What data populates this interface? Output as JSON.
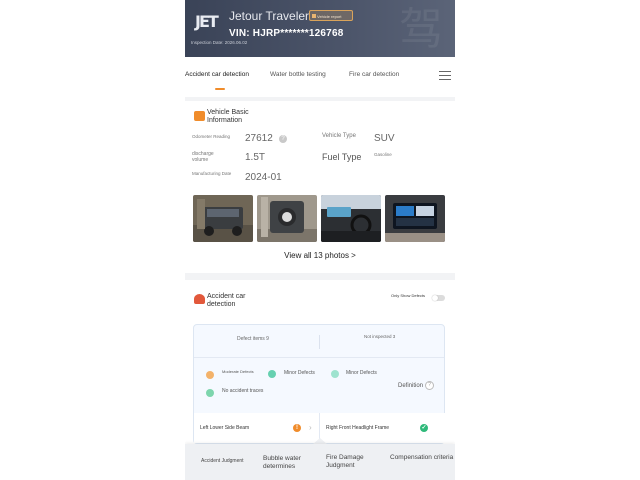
{
  "header": {
    "brand_logo": "JET",
    "car_model": "Jetour Traveler",
    "report_badge": "Vehicle report",
    "vin": "VIN: HJRP*******126768",
    "inspection_date": "Inspection Date: 2026.06.02",
    "watermark": "驾"
  },
  "tabs": [
    {
      "label": "Accident car detection",
      "active": true
    },
    {
      "label": "Water bottle testing",
      "active": false
    },
    {
      "label": "Fire car detection",
      "active": false
    }
  ],
  "basic_info": {
    "title_line1": "Vehicle Basic",
    "title_line2": "Information",
    "odometer_label": "Odometer Reading",
    "odometer_value": "27612",
    "vehicle_type_label": "Vehicle Type",
    "vehicle_type_value": "SUV",
    "displacement_label_line1": "discharge",
    "displacement_label_line2": "volume",
    "displacement_value": "1.5T",
    "fuel_type_label": "Fuel Type",
    "fuel_type_value": "Gasoline",
    "manufacture_label": "Manufacturing Date",
    "manufacture_value": "2024-01",
    "view_all": "View all 13 photos >"
  },
  "accident": {
    "title_line1": "Accident car",
    "title_line2": "detection",
    "only_show_defects": "Only Show Defects",
    "defect_items": "Defect items 9",
    "not_inspected": "Not inspected 3",
    "legend": {
      "moderate": "Moderate Defects",
      "minor1": "Minor Defects",
      "minor2": "Minor Defects",
      "no_accident": "No accident traces",
      "definition": "Definition"
    },
    "rows": [
      {
        "label": "Left Lower Side Beam",
        "status": "warning"
      },
      {
        "label": "Right Front Headlight Frame",
        "status": "ok"
      }
    ]
  },
  "bottom_tabs": [
    "Accident Judgment",
    "Bubble water determines",
    "Fire Damage Judgment",
    "Compensation criteria"
  ],
  "colors": {
    "accent_orange": "#f08c2b",
    "ok_green": "#2fb97a",
    "minor_teal": "#66d0b0",
    "header_bg": "#3a4357"
  },
  "icons": {
    "help": "question-circle-icon",
    "menu": "hamburger-menu-icon",
    "section": "report-icon",
    "status_ok": "check-circle-icon",
    "status_warn": "exclamation-circle-icon"
  }
}
